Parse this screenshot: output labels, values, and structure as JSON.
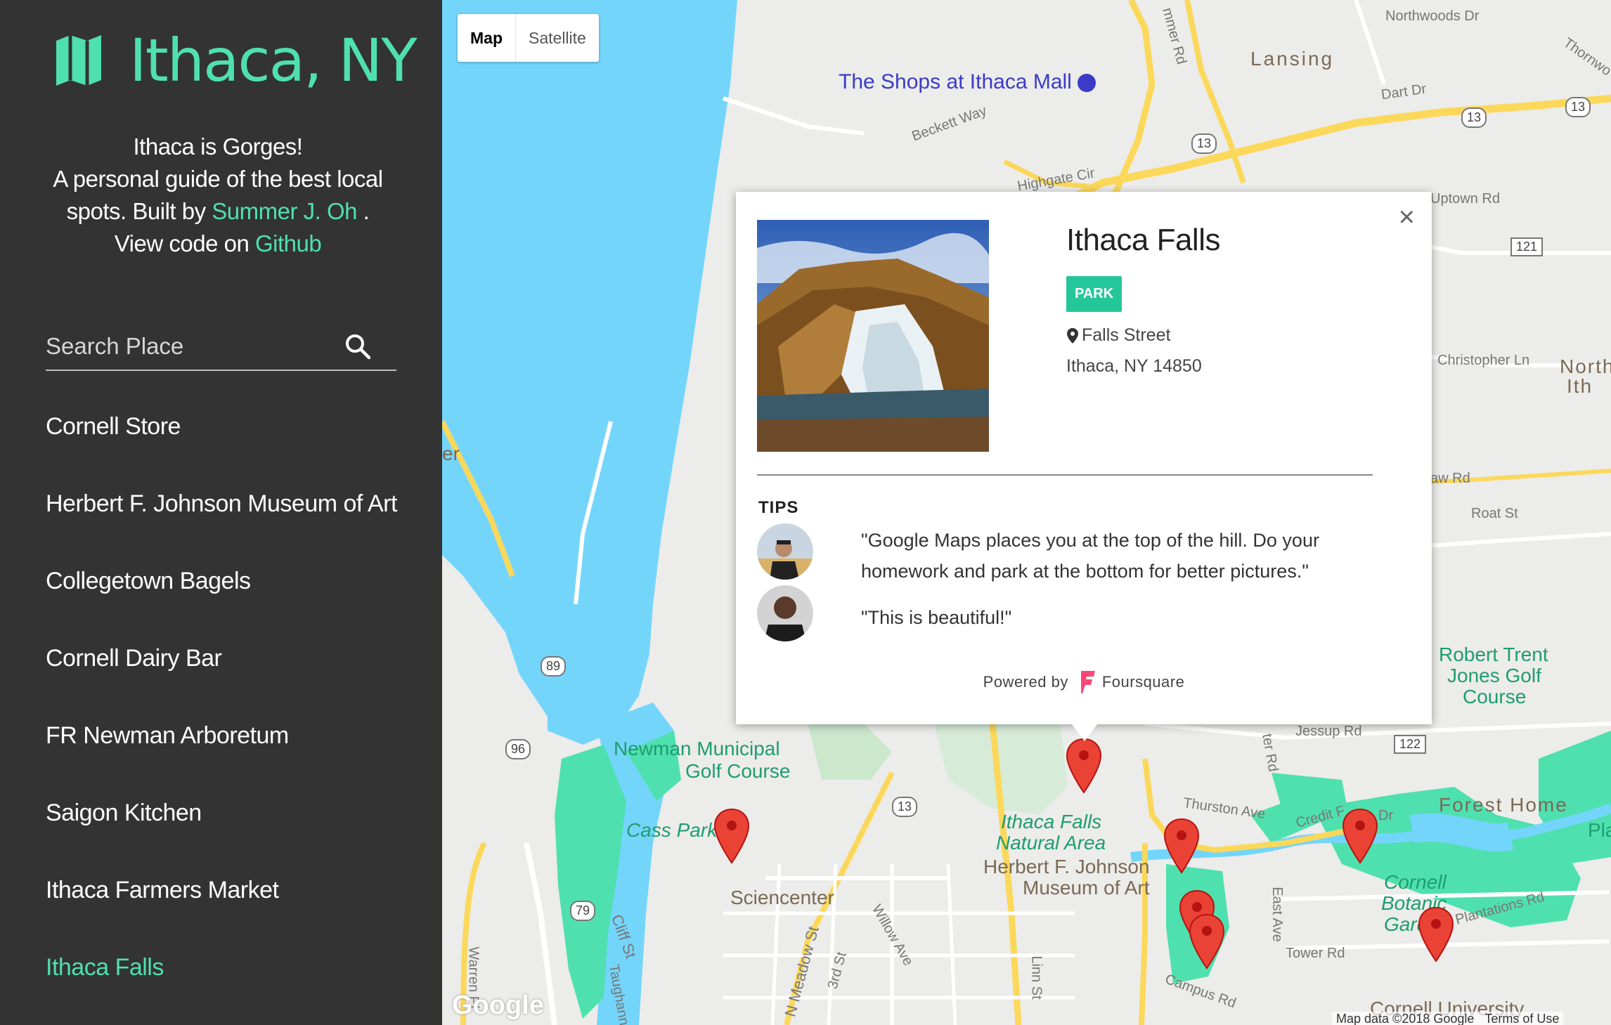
{
  "app": {
    "title": "Ithaca, NY",
    "tagline": "Ithaca is Gorges!",
    "intro": "A personal guide of the best local spots. Built by",
    "author": "Summer J. Oh",
    "view_text": ". View code on",
    "github": "Github",
    "brand_color": "#4fe0b0",
    "sidebar_bg": "#333333"
  },
  "search": {
    "placeholder": "Search Place"
  },
  "places": [
    "Cornell Store",
    "Herbert F. Johnson Museum of Art",
    "Collegetown Bagels",
    "Cornell Dairy Bar",
    "FR Newman Arboretum",
    "Saigon Kitchen",
    "Ithaca Farmers Market",
    "Ithaca Falls"
  ],
  "active_place": "Ithaca Falls",
  "map_type": {
    "map": "Map",
    "satellite": "Satellite",
    "selected": "Map"
  },
  "infowindow": {
    "name": "Ithaca Falls",
    "category": "PARK",
    "address_line1": "Falls Street",
    "address_line2": "Ithaca, NY 14850",
    "tips_title": "TIPS",
    "tips": [
      "\"Google Maps places you at the top of the hill. Do your homework and park at the bottom for better pictures.\"",
      "\"This is beautiful!\""
    ],
    "powered_by": "Powered by",
    "provider": "Foursquare",
    "category_color": "#25c79a",
    "provider_color": "#f94877"
  },
  "map_labels": {
    "lansing": "Lansing",
    "shops": "The Shops at Ithaca Mall",
    "northwoods": "Northwoods Dr",
    "thornwood": "Thornwo",
    "dart": "Dart Dr",
    "beckett": "Beckett Way",
    "highgate": "Highgate Cir",
    "uptown": "Uptown Rd",
    "christopher": "Christopher Ln",
    "north_ith_1": "North",
    "north_ith_2": "Ith",
    "roat": "Roat St",
    "warren_rd": "aw Rd",
    "hammer": "mmer Rd",
    "er": "er",
    "robert_trent_1": "Robert Trent",
    "robert_trent_2": "Jones Golf",
    "robert_trent_3": "Course",
    "jessup": "Jessup Rd",
    "newman_1": "Newman Municipal",
    "newman_2": "Golf Course",
    "cass": "Cass Park",
    "sciencenter": "Sciencenter",
    "falls_area_1": "Ithaca Falls",
    "falls_area_2": "Natural Area",
    "johnson_1": "Herbert F. Johnson",
    "johnson_2": "Museum of Art",
    "thurston": "Thurston Ave",
    "forest_home": "Forest Home",
    "pla": "Pla",
    "botanic_1": "Cornell",
    "botanic_2": "Botanic",
    "botanic_3": "Garden",
    "plantations": "Plantations Rd",
    "credit": "Credit F",
    "tower": "Tower Rd",
    "campus": "Campus Rd",
    "cornell_univ": "Cornell University",
    "cliff": "Cliff St",
    "meadow": "N Meadow St",
    "third": "3rd St",
    "willow": "Willow Ave",
    "linn": "Linn St",
    "east": "East Ave",
    "warren_pl": "Warren Pl",
    "taughannock": "Taughannock",
    "ter": "ter Rd",
    "dr_label": "Dr",
    "google": "Google",
    "attribution": "Map data ©2018 Google",
    "terms": "Terms of Use",
    "r13a": "13",
    "r13b": "13",
    "r13c": "13",
    "r13d": "13",
    "r121": "121",
    "r122": "122",
    "r89": "89",
    "r96": "96",
    "r79": "79"
  }
}
